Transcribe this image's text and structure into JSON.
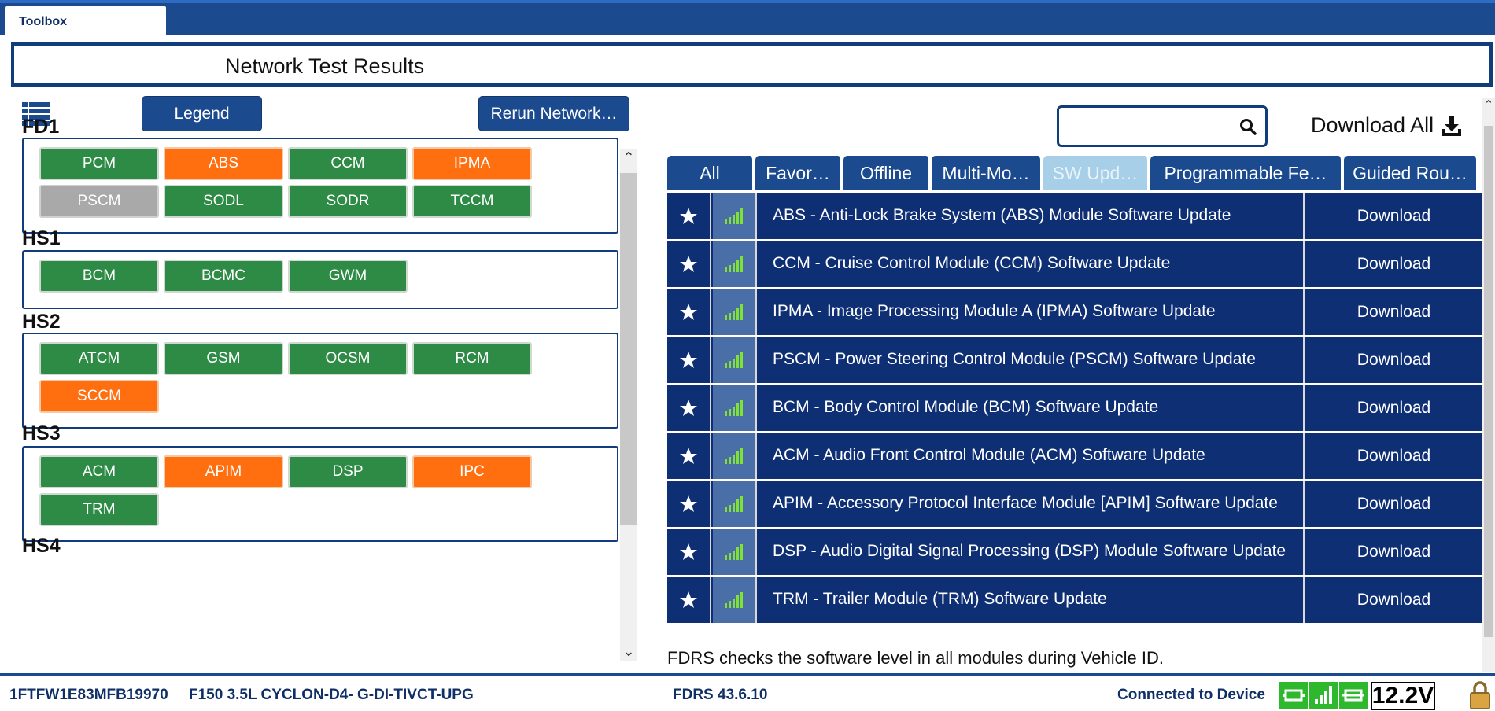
{
  "window": {
    "tab_label": "Toolbox"
  },
  "page": {
    "title": "Network Test Results"
  },
  "left": {
    "legend_button": "Legend",
    "rerun_button": "Rerun Network…",
    "networks": [
      {
        "name": "FD1",
        "modules": [
          {
            "label": "PCM",
            "status": "green"
          },
          {
            "label": "ABS",
            "status": "orange"
          },
          {
            "label": "CCM",
            "status": "green"
          },
          {
            "label": "IPMA",
            "status": "orange"
          },
          {
            "label": "PSCM",
            "status": "gray"
          },
          {
            "label": "SODL",
            "status": "green"
          },
          {
            "label": "SODR",
            "status": "green"
          },
          {
            "label": "TCCM",
            "status": "green"
          }
        ]
      },
      {
        "name": "HS1",
        "modules": [
          {
            "label": "BCM",
            "status": "green"
          },
          {
            "label": "BCMC",
            "status": "green"
          },
          {
            "label": "GWM",
            "status": "green"
          }
        ]
      },
      {
        "name": "HS2",
        "modules": [
          {
            "label": "ATCM",
            "status": "green"
          },
          {
            "label": "GSM",
            "status": "green"
          },
          {
            "label": "OCSM",
            "status": "green"
          },
          {
            "label": "RCM",
            "status": "green"
          },
          {
            "label": "SCCM",
            "status": "orange"
          }
        ]
      },
      {
        "name": "HS3",
        "modules": [
          {
            "label": "ACM",
            "status": "green"
          },
          {
            "label": "APIM",
            "status": "orange"
          },
          {
            "label": "DSP",
            "status": "green"
          },
          {
            "label": "IPC",
            "status": "orange"
          },
          {
            "label": "TRM",
            "status": "green"
          }
        ]
      },
      {
        "name": "HS4",
        "modules": []
      }
    ]
  },
  "right": {
    "search_placeholder": "",
    "download_all": "Download All",
    "tabs": [
      {
        "label": "All",
        "active": false
      },
      {
        "label": "Favor…",
        "active": false
      },
      {
        "label": "Offline",
        "active": false
      },
      {
        "label": "Multi-Mo…",
        "active": false
      },
      {
        "label": "SW Upd…",
        "active": true
      },
      {
        "label": "Programmable Fe…",
        "active": false
      },
      {
        "label": "Guided Rou…",
        "active": false
      }
    ],
    "rows": [
      {
        "desc": "ABS - Anti-Lock Brake System (ABS) Module Software Update",
        "action": "Download"
      },
      {
        "desc": "CCM - Cruise Control Module (CCM) Software Update",
        "action": "Download"
      },
      {
        "desc": "IPMA - Image Processing Module A (IPMA) Software Update",
        "action": "Download"
      },
      {
        "desc": "PSCM - Power Steering Control Module (PSCM) Software Update",
        "action": "Download"
      },
      {
        "desc": "BCM - Body Control Module (BCM) Software Update",
        "action": "Download"
      },
      {
        "desc": "ACM - Audio Front Control Module (ACM) Software Update",
        "action": "Download"
      },
      {
        "desc": "APIM - Accessory Protocol Interface Module [APIM] Software Update",
        "action": "Download"
      },
      {
        "desc": "DSP - Audio Digital Signal Processing (DSP) Module Software Update",
        "action": "Download"
      },
      {
        "desc": "TRM - Trailer Module (TRM) Software Update",
        "action": "Download"
      }
    ],
    "note": "FDRS checks the software level in all modules during Vehicle ID."
  },
  "status": {
    "vin": "1FTFW1E83MFB19970",
    "vehicle": "F150 3.5L CYCLON-D4- G-DI-TIVCT-UPG",
    "version": "FDRS 43.6.10",
    "connection": "Connected to Device",
    "voltage": "12.2V"
  },
  "colors": {
    "brand_blue": "#1b4a8f",
    "row_blue": "#0f2f75",
    "ok_green": "#2e8b45",
    "warn_orange": "#ff6f0f",
    "inactive_gray": "#a9a9a9",
    "signal_green": "#7fe03a"
  }
}
